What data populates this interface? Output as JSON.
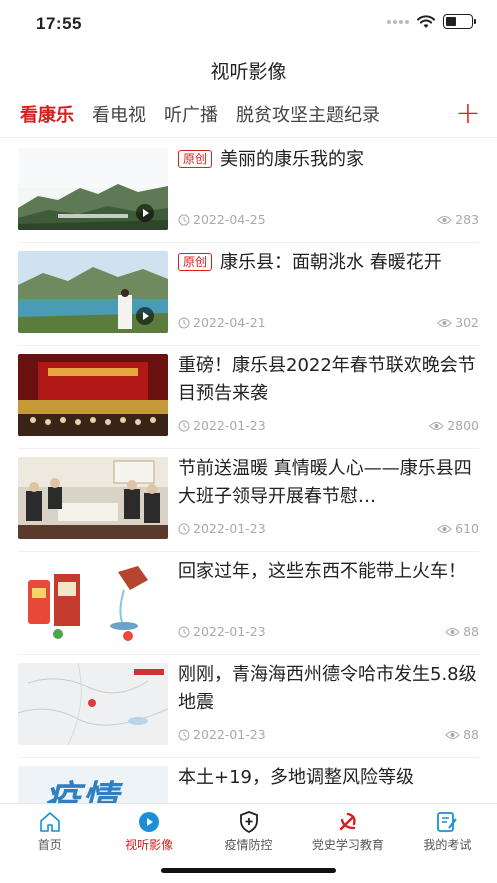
{
  "status_bar": {
    "time": "17:55"
  },
  "header": {
    "title": "视听影像"
  },
  "tabs": [
    {
      "label": "看康乐",
      "active": true
    },
    {
      "label": "看电视",
      "active": false
    },
    {
      "label": "听广播",
      "active": false
    },
    {
      "label": "脱贫攻坚主题纪录",
      "active": false
    }
  ],
  "add_tab_label": "+",
  "news": [
    {
      "badge": "原创",
      "title": "美丽的康乐我的家",
      "date": "2022-04-25",
      "views": "283",
      "thumb": "mountain-village",
      "video": true
    },
    {
      "badge": "原创",
      "title": "康乐县：面朝洮水 春暖花开",
      "date": "2022-04-21",
      "views": "302",
      "thumb": "lake-scenery",
      "video": true
    },
    {
      "badge": "",
      "title": "重磅！康乐县2022年春节联欢晚会节目预告来袭",
      "date": "2022-01-23",
      "views": "2800",
      "thumb": "stage-performance",
      "video": false
    },
    {
      "badge": "",
      "title": "节前送温暖 真情暖人心——康乐县四大班子领导开展春节慰…",
      "date": "2022-01-23",
      "views": "610",
      "thumb": "meeting-room",
      "video": false
    },
    {
      "badge": "",
      "title": "回家过年，这些东西不能带上火车！",
      "date": "2022-01-23",
      "views": "88",
      "thumb": "liquor-illustration",
      "video": false
    },
    {
      "badge": "",
      "title": "刚刚，青海海西州德令哈市发生5.8级地震",
      "date": "2022-01-23",
      "views": "88",
      "thumb": "map",
      "video": false
    },
    {
      "badge": "",
      "title": "本土+19，多地调整风险等级",
      "date": "",
      "views": "",
      "thumb": "epidemic-text",
      "video": false
    }
  ],
  "thumb_texts": {
    "epidemic": "疫情"
  },
  "bottom_nav": [
    {
      "label": "首页",
      "icon": "home-icon",
      "active": false
    },
    {
      "label": "视听影像",
      "icon": "play-circle-icon",
      "active": true
    },
    {
      "label": "疫情防控",
      "icon": "shield-plus-icon",
      "active": false
    },
    {
      "label": "党史学习教育",
      "icon": "party-emblem-icon",
      "active": false
    },
    {
      "label": "我的考试",
      "icon": "exam-edit-icon",
      "active": false
    }
  ],
  "colors": {
    "accent": "#d81e1e",
    "nav_blue": "#1a8fd8",
    "meta": "#aaaaaa"
  }
}
